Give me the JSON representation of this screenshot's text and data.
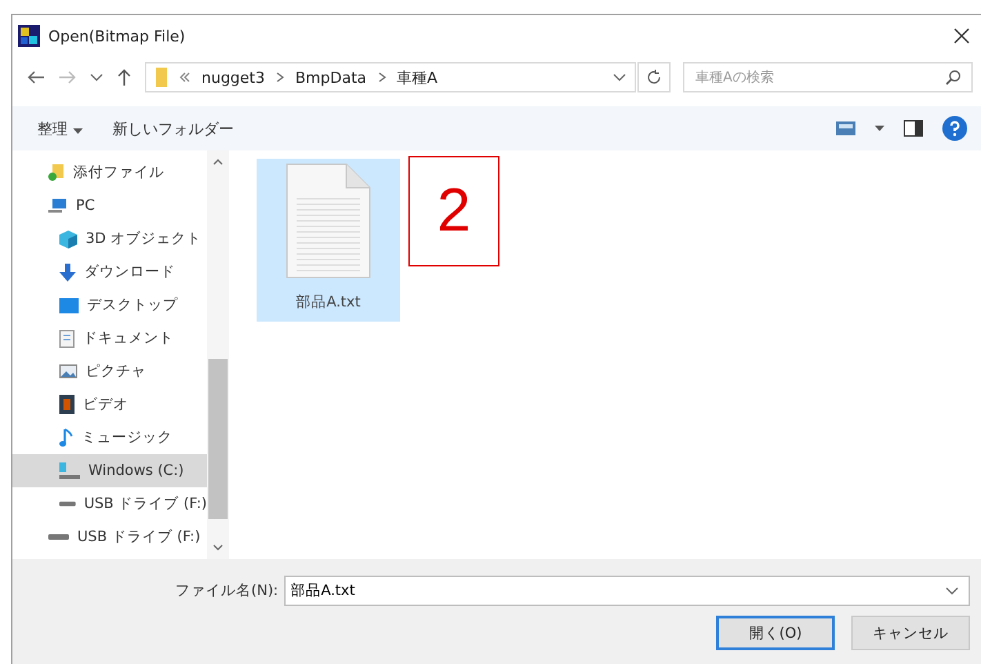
{
  "window": {
    "title": "Open(Bitmap File)"
  },
  "address_bar": {
    "breadcrumbs": [
      "nugget3",
      "BmpData",
      "車種A"
    ]
  },
  "search": {
    "placeholder": "車種Aの検索"
  },
  "toolbar": {
    "organize": "整理",
    "new_folder": "新しいフォルダー"
  },
  "sidebar": {
    "items": [
      {
        "label": "添付ファイル",
        "kind": "folder",
        "selected": false
      },
      {
        "label": "PC",
        "kind": "pc",
        "selected": false,
        "children": [
          {
            "label": "3D オブジェクト",
            "kind": "objects3d",
            "selected": false
          },
          {
            "label": "ダウンロード",
            "kind": "download",
            "selected": false
          },
          {
            "label": "デスクトップ",
            "kind": "desktop",
            "selected": false
          },
          {
            "label": "ドキュメント",
            "kind": "documents",
            "selected": false
          },
          {
            "label": "ピクチャ",
            "kind": "pictures",
            "selected": false
          },
          {
            "label": "ビデオ",
            "kind": "videos",
            "selected": false
          },
          {
            "label": "ミュージック",
            "kind": "music",
            "selected": false
          },
          {
            "label": "Windows (C:)",
            "kind": "drive",
            "selected": true
          },
          {
            "label": "USB ドライブ (F:)",
            "kind": "usb",
            "selected": false
          }
        ]
      },
      {
        "label": "USB ドライブ (F:)",
        "kind": "usb",
        "selected": false
      }
    ]
  },
  "files": [
    {
      "name": "部品A.txt",
      "selected": true
    }
  ],
  "annotation": {
    "text": "2"
  },
  "file_name": {
    "label": "ファイル名(N):",
    "value": "部品A.txt"
  },
  "buttons": [
    {
      "label": "開く(O)",
      "kind": "primary"
    },
    {
      "label": "キャンセル",
      "kind": "secondary"
    }
  ]
}
